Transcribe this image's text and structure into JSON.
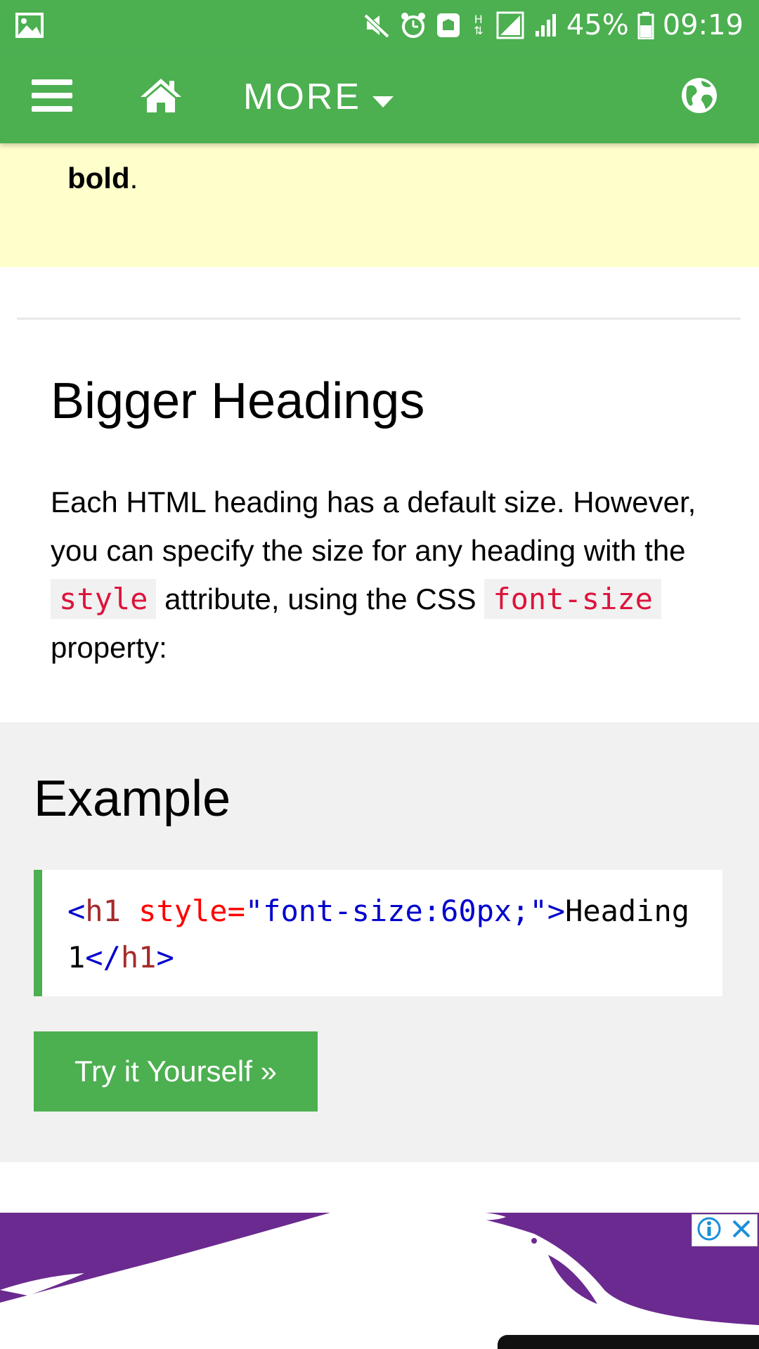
{
  "status_bar": {
    "battery_percent": "45%",
    "time": "09:19",
    "network_type": "H",
    "icons": [
      "gallery-icon",
      "mute-icon",
      "alarm-icon",
      "nfc-icon",
      "data-arrows-icon",
      "signal-icon",
      "signal-icon",
      "battery-icon"
    ]
  },
  "nav": {
    "more_label": "MORE",
    "icons": [
      "menu-icon",
      "home-icon",
      "caret-down-icon",
      "globe-icon"
    ]
  },
  "note": {
    "bold_word": "bold",
    "trailing": "."
  },
  "section": {
    "heading": "Bigger Headings",
    "para_part1": "Each HTML heading has a default size. However, you can specify the size for any heading with the ",
    "code1": "style",
    "para_part2": " attribute, using the CSS ",
    "code2": "font-size",
    "para_part3": " property:"
  },
  "example": {
    "heading": "Example",
    "code": {
      "open_lt": "<",
      "tag_h1": "h1",
      "attr": " style=",
      "value": "\"font-size:60px;\"",
      "close_gt": ">",
      "text": "Heading 1",
      "end_lt": "</",
      "end_tag": "h1",
      "end_gt": ">"
    },
    "button_label": "Try it Yourself »"
  },
  "ad": {
    "icons": [
      "adchoices-info-icon",
      "ad-close-icon"
    ]
  },
  "colors": {
    "brand_green": "#4caf50",
    "note_yellow": "#ffffcc",
    "panel_gray": "#f1f1f1",
    "code_red": "#dc143c",
    "ad_purple": "#6b2a90"
  }
}
